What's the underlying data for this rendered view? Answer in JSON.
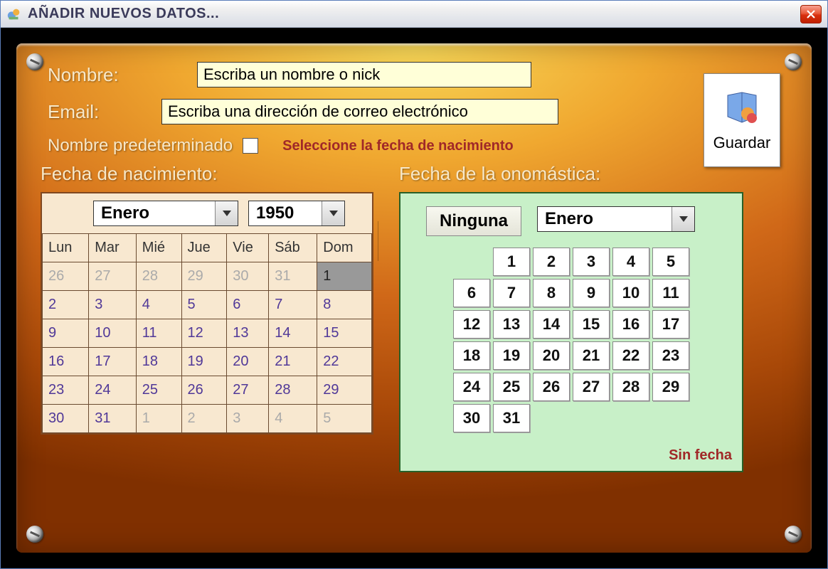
{
  "window": {
    "title": "AÑADIR NUEVOS DATOS..."
  },
  "form": {
    "name_label": "Nombre:",
    "name_value": "Escriba un nombre o nick",
    "email_label": "Email:",
    "email_value": "Escriba una dirección de correo electrónico",
    "default_name_label": "Nombre predeterminado",
    "hint": "Seleccione la fecha de nacimiento",
    "save_label": "Guardar"
  },
  "birth": {
    "title": "Fecha de nacimiento:",
    "month": "Enero",
    "year": "1950",
    "headers": [
      "Lun",
      "Mar",
      "Mié",
      "Jue",
      "Vie",
      "Sáb",
      "Dom"
    ],
    "grid": [
      [
        {
          "d": "26",
          "out": true
        },
        {
          "d": "27",
          "out": true
        },
        {
          "d": "28",
          "out": true
        },
        {
          "d": "29",
          "out": true
        },
        {
          "d": "30",
          "out": true
        },
        {
          "d": "31",
          "out": true
        },
        {
          "d": "1",
          "sel": true
        }
      ],
      [
        {
          "d": "2"
        },
        {
          "d": "3"
        },
        {
          "d": "4"
        },
        {
          "d": "5"
        },
        {
          "d": "6"
        },
        {
          "d": "7"
        },
        {
          "d": "8"
        }
      ],
      [
        {
          "d": "9"
        },
        {
          "d": "10"
        },
        {
          "d": "11"
        },
        {
          "d": "12"
        },
        {
          "d": "13"
        },
        {
          "d": "14"
        },
        {
          "d": "15"
        }
      ],
      [
        {
          "d": "16"
        },
        {
          "d": "17"
        },
        {
          "d": "18"
        },
        {
          "d": "19"
        },
        {
          "d": "20"
        },
        {
          "d": "21"
        },
        {
          "d": "22"
        }
      ],
      [
        {
          "d": "23"
        },
        {
          "d": "24"
        },
        {
          "d": "25"
        },
        {
          "d": "26"
        },
        {
          "d": "27"
        },
        {
          "d": "28"
        },
        {
          "d": "29"
        }
      ],
      [
        {
          "d": "30"
        },
        {
          "d": "31"
        },
        {
          "d": "1",
          "out": true
        },
        {
          "d": "2",
          "out": true
        },
        {
          "d": "3",
          "out": true
        },
        {
          "d": "4",
          "out": true
        },
        {
          "d": "5",
          "out": true
        }
      ]
    ]
  },
  "onom": {
    "title": "Fecha de la onomástica:",
    "none_label": "Ninguna",
    "month": "Enero",
    "no_date_label": "Sin fecha",
    "row1": [
      "1",
      "2",
      "3",
      "4",
      "5"
    ],
    "rows": [
      [
        "6",
        "7",
        "8",
        "9",
        "10",
        "11"
      ],
      [
        "12",
        "13",
        "14",
        "15",
        "16",
        "17"
      ],
      [
        "18",
        "19",
        "20",
        "21",
        "22",
        "23"
      ],
      [
        "24",
        "25",
        "26",
        "27",
        "28",
        "29"
      ]
    ],
    "last_row": [
      "30",
      "31"
    ]
  }
}
